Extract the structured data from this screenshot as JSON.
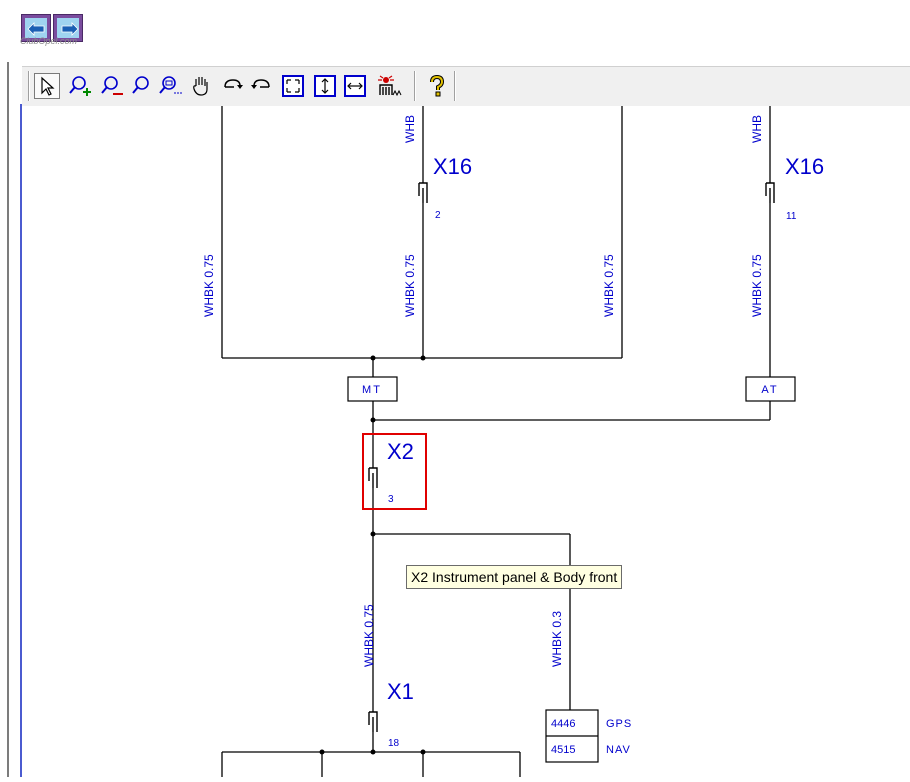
{
  "watermark": "ClubOpel.com",
  "nav": {
    "back_icon": "arrow-left-icon",
    "forward_icon": "arrow-right-icon"
  },
  "toolbar": {
    "tools": [
      {
        "name": "select-pointer-icon"
      },
      {
        "name": "zoom-in-icon"
      },
      {
        "name": "zoom-out-icon"
      },
      {
        "name": "zoom-icon"
      },
      {
        "name": "zoom-window-icon"
      },
      {
        "name": "pan-hand-icon"
      },
      {
        "name": "rotate-forward-icon"
      },
      {
        "name": "rotate-back-icon"
      },
      {
        "name": "fit-all-icon"
      },
      {
        "name": "fit-height-icon"
      },
      {
        "name": "fit-width-icon"
      },
      {
        "name": "component-locator-icon"
      },
      {
        "name": "help-icon"
      }
    ],
    "colors": {
      "accent": "#0000cc",
      "help": "#e0c000",
      "locator": "#cc0000"
    }
  },
  "diagram": {
    "wire_labels": {
      "w1": "WHBK 0.75",
      "w2": "WHBK 0.75",
      "w3": "WHBK 0.75",
      "w4": "WHBK 0.75",
      "w5": "WHBK 0.75",
      "w6": "WHBK 0.3",
      "top1": "WHB",
      "top2": "WHB"
    },
    "connectors": {
      "x16a": {
        "name": "X16",
        "pin": "2"
      },
      "x16b": {
        "name": "X16",
        "pin": "11"
      },
      "x2": {
        "name": "X2",
        "pin": "3"
      },
      "x1": {
        "name": "X1",
        "pin": "18"
      }
    },
    "boxes": {
      "mt": "MT",
      "at": "AT"
    },
    "codes": [
      {
        "code": "4446",
        "label": "GPS"
      },
      {
        "code": "4515",
        "label": "NAV"
      }
    ],
    "colors": {
      "wire": "#000000",
      "label": "#0000cc",
      "highlight": "#e00000"
    }
  },
  "tooltip": "X2 Instrument panel & Body front"
}
